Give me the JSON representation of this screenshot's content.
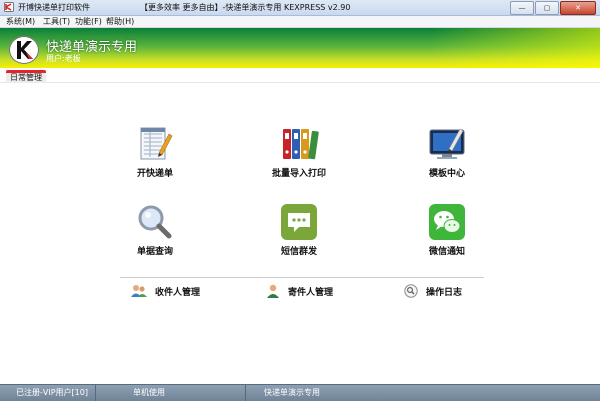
{
  "window": {
    "title": "开博快递单打印软件",
    "subtitle": "【更多效率 更多自由】-快递单演示专用   KEXPRESS  v2.90",
    "controls": {
      "minimize": "—",
      "maximize": "▢",
      "close": "✕"
    }
  },
  "menu": [
    "系统(M)",
    "工具(T)",
    "功能(F)",
    "帮助(H)"
  ],
  "banner": {
    "title": "快递单演示专用",
    "user": "用户:老板",
    "logo_letter": "K"
  },
  "tabs": [
    {
      "label": "日常管理",
      "active": true
    }
  ],
  "tiles": [
    {
      "label": "开快递单",
      "icon": "form-pen-icon"
    },
    {
      "label": "批量导入打印",
      "icon": "binders-icon"
    },
    {
      "label": "模板中心",
      "icon": "monitor-pen-icon"
    },
    {
      "label": "单据查询",
      "icon": "magnifier-icon"
    },
    {
      "label": "短信群发",
      "icon": "sms-bubble-icon"
    },
    {
      "label": "微信通知",
      "icon": "wechat-icon"
    }
  ],
  "managers": [
    {
      "label": "收件人管理",
      "icon": "users-group-icon"
    },
    {
      "label": "寄件人管理",
      "icon": "user-icon"
    },
    {
      "label": "操作日志",
      "icon": "search-log-icon"
    }
  ],
  "status": [
    "已注册-VIP用户[10]",
    "单机使用",
    "快递单演示专用"
  ],
  "colors": {
    "accent_red": "#e2242c",
    "banner_green": "#0a7f3a",
    "banner_yellow": "#f6f000"
  }
}
